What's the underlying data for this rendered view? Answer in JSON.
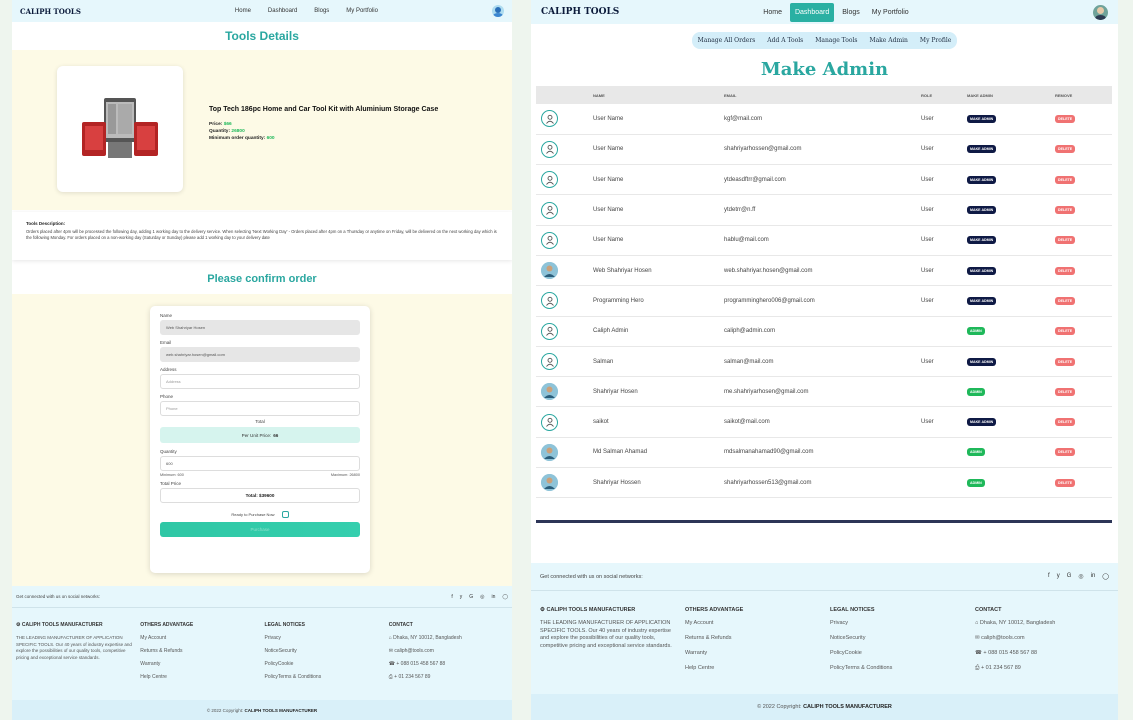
{
  "brand": "CALIPH TOOLS",
  "nav": {
    "home": "Home",
    "dashboard": "Dashboard",
    "blogs": "Blogs",
    "portfolio": "My Portfolio"
  },
  "tool": {
    "section_title": "Tools Details",
    "name": "Top Tech 186pc Home and Car Tool Kit with Aluminium Storage Case",
    "price_label": "Price:",
    "price": "$66",
    "quantity_label": "Quantity:",
    "quantity": "26800",
    "min_label": "Minimum order quantity:",
    "min": "600",
    "desc_title": "Tools Description:",
    "desc": "Orders placed after 4pm will be processed the following day, adding 1 working day to the delivery service. When selecting 'Next Working Day' - Orders placed after 4pm on a Thursday or anytime on Friday, will be delivered on the next working day which is the following Monday. For orders placed on a non-working day (Saturday or Sunday) please add 1 working day to your delivery date"
  },
  "order": {
    "title": "Please confirm order",
    "name_label": "Name",
    "name_value": "Web Shahriyar Hosen",
    "email_label": "Email",
    "email_value": "web.shahriyar.hosen@gmail.com",
    "address_label": "Address",
    "address_placeholder": "Address",
    "phone_label": "Phone",
    "phone_placeholder": "Phone",
    "total_label": "Total",
    "unit_price_text": "Per Unit Price:",
    "unit_price": "66",
    "quantity_label": "Quantity",
    "quantity_value": "600",
    "min_text": "Minimum: 600",
    "max_text": "Maximum: 26800",
    "total_price_label": "Total Price",
    "total_value": "Total: $39600",
    "ready_label": "Ready to Purchase Now",
    "purchase_button": "Purchase"
  },
  "footer": {
    "social_text": "Get connected with us on social networks:",
    "social_icons": [
      "f",
      "y",
      "G",
      "◎",
      "in",
      "◯"
    ],
    "company_title": "CALIPH TOOLS MANUFACTURER",
    "company_text": "THE LEADING MANUFACTURER OF APPLICATION SPECIFIC TOOLS. Our 40 years of industry expertise and explore the possibilities of our quality tools, competitive pricing and exceptional service standards.",
    "adv_title": "OTHERS ADVANTAGE",
    "adv_items": [
      "My Account",
      "Returns & Refunds",
      "Warranty",
      "Help Centre"
    ],
    "legal_title": "LEGAL NOTICES",
    "legal_items": [
      "Privacy",
      "NoticeSecurity",
      "PolicyCookie",
      "PolicyTerms & Conditions"
    ],
    "contact_title": "CONTACT",
    "contact_items": [
      {
        "icon": "home-icon",
        "text": "Dhaka, NY 10012, Bangladesh"
      },
      {
        "icon": "mail-icon",
        "text": "caliph@tools.com"
      },
      {
        "icon": "phone-icon",
        "text": "+ 088 015 458 567 88"
      },
      {
        "icon": "printer-icon",
        "text": "+ 01 234 567 89"
      }
    ],
    "copyright_prefix": "© 2022 Copyright:",
    "copyright_name": "CALIPH TOOLS MANUFACTURER"
  },
  "dashboard": {
    "subnav": [
      "Manage All Orders",
      "Add A Tools",
      "Manage Tools",
      "Make Admin",
      "My Profile"
    ],
    "title": "Make Admin",
    "headers": [
      "NAME",
      "EMAIL",
      "ROLE",
      "MAKE ADMIN",
      "REMOVE"
    ],
    "rows": [
      {
        "avatar": "placeholder",
        "name": "User Name",
        "email": "kgf@mail.com",
        "role": "User",
        "action": "MAKE ADMIN",
        "remove": "DELETE"
      },
      {
        "avatar": "placeholder",
        "name": "User Name",
        "email": "shahriyarhossen@gmail.com",
        "role": "User",
        "action": "MAKE ADMIN",
        "remove": "DELETE"
      },
      {
        "avatar": "placeholder",
        "name": "User Name",
        "email": "ytdeasdftrr@gmail.com",
        "role": "User",
        "action": "MAKE ADMIN",
        "remove": "DELETE"
      },
      {
        "avatar": "placeholder",
        "name": "User Name",
        "email": "ytdetrr@n.ff",
        "role": "User",
        "action": "MAKE ADMIN",
        "remove": "DELETE"
      },
      {
        "avatar": "placeholder",
        "name": "User Name",
        "email": "hablu@mail.com",
        "role": "User",
        "action": "MAKE ADMIN",
        "remove": "DELETE"
      },
      {
        "avatar": "photo",
        "name": "Web Shahriyar Hosen",
        "email": "web.shahriyar.hosen@gmail.com",
        "role": "User",
        "action": "MAKE ADMIN",
        "remove": "DELETE"
      },
      {
        "avatar": "placeholder",
        "name": "Programming Hero",
        "email": "programminghero006@gmail.com",
        "role": "User",
        "action": "MAKE ADMIN",
        "remove": "DELETE"
      },
      {
        "avatar": "placeholder",
        "name": "Caliph Admin",
        "email": "caliph@admin.com",
        "role": "",
        "action": "ADMIN",
        "remove": "DELETE"
      },
      {
        "avatar": "placeholder",
        "name": "Salman",
        "email": "salman@mail.com",
        "role": "User",
        "action": "MAKE ADMIN",
        "remove": "DELETE"
      },
      {
        "avatar": "photo",
        "name": "Shahriyar Hosen",
        "email": "me.shahriyarhosen@gmail.com",
        "role": "",
        "action": "ADMIN",
        "remove": "DELETE"
      },
      {
        "avatar": "placeholder",
        "name": "saikot",
        "email": "saikot@mail.com",
        "role": "User",
        "action": "MAKE ADMIN",
        "remove": "DELETE"
      },
      {
        "avatar": "photo",
        "name": "Md Salman Ahamad",
        "email": "mdsalmanahamad90@gmail.com",
        "role": "",
        "action": "ADMIN",
        "remove": "DELETE"
      },
      {
        "avatar": "photo",
        "name": "Shahriyar Hossen",
        "email": "shahriyarhossen513@gmail.com",
        "role": "",
        "action": "ADMIN",
        "remove": "DELETE"
      }
    ]
  },
  "colors": {
    "teal": "#2aa7a0",
    "navy": "#0f1a45",
    "green": "#1fb85a",
    "red": "#f07272",
    "footer_bg": "#e6f7fc",
    "cream": "#fdfae6"
  }
}
